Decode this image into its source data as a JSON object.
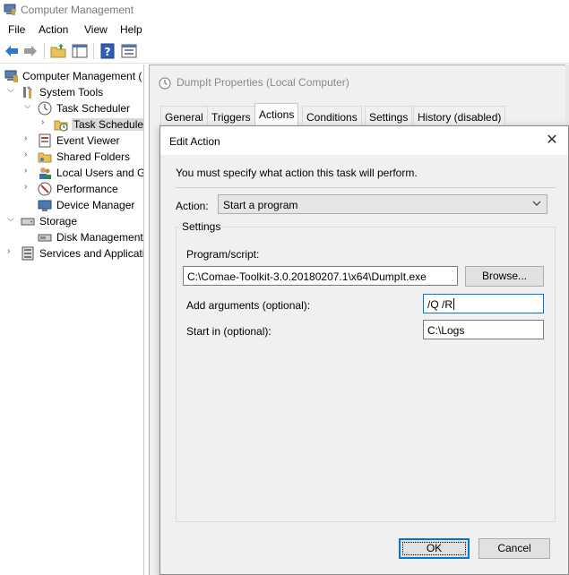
{
  "window": {
    "title": "Computer Management"
  },
  "menu": [
    "File",
    "Action",
    "View",
    "Help"
  ],
  "toolbar": {
    "buttons": [
      "back-arrow-icon",
      "forward-arrow-icon",
      "up-folder-icon",
      "show-hide-tree-icon",
      "help-icon",
      "properties-icon"
    ]
  },
  "tree": {
    "root": "Computer Management (",
    "system_tools": "System Tools",
    "task_scheduler": "Task Scheduler",
    "task_scheduler_lib": "Task Scheduler",
    "event_viewer": "Event Viewer",
    "shared_folders": "Shared Folders",
    "local_users": "Local Users and Gr",
    "performance": "Performance",
    "device_manager": "Device Manager",
    "storage": "Storage",
    "disk_management": "Disk Management",
    "services": "Services and Applicati"
  },
  "properties": {
    "title": "DumpIt Properties (Local Computer)",
    "tabs": [
      "General",
      "Triggers",
      "Actions",
      "Conditions",
      "Settings",
      "History (disabled)"
    ],
    "active_tab": "Actions"
  },
  "dialog": {
    "title": "Edit Action",
    "message": "You must specify what action this task will perform.",
    "action_label": "Action:",
    "action_value": "Start a program",
    "settings_label": "Settings",
    "program_label": "Program/script:",
    "program_value": "C:\\Comae-Toolkit-3.0.20180207.1\\x64\\DumpIt.exe",
    "browse_label": "Browse...",
    "arguments_label": "Add arguments (optional):",
    "arguments_value": "/Q /R",
    "startin_label": "Start in (optional):",
    "startin_value": "C:\\Logs",
    "ok_label": "OK",
    "cancel_label": "Cancel"
  },
  "colors": {
    "accent": "#0078d7",
    "title_gray": "#7a7a7a",
    "dialog_bg": "#f0f0f0"
  }
}
